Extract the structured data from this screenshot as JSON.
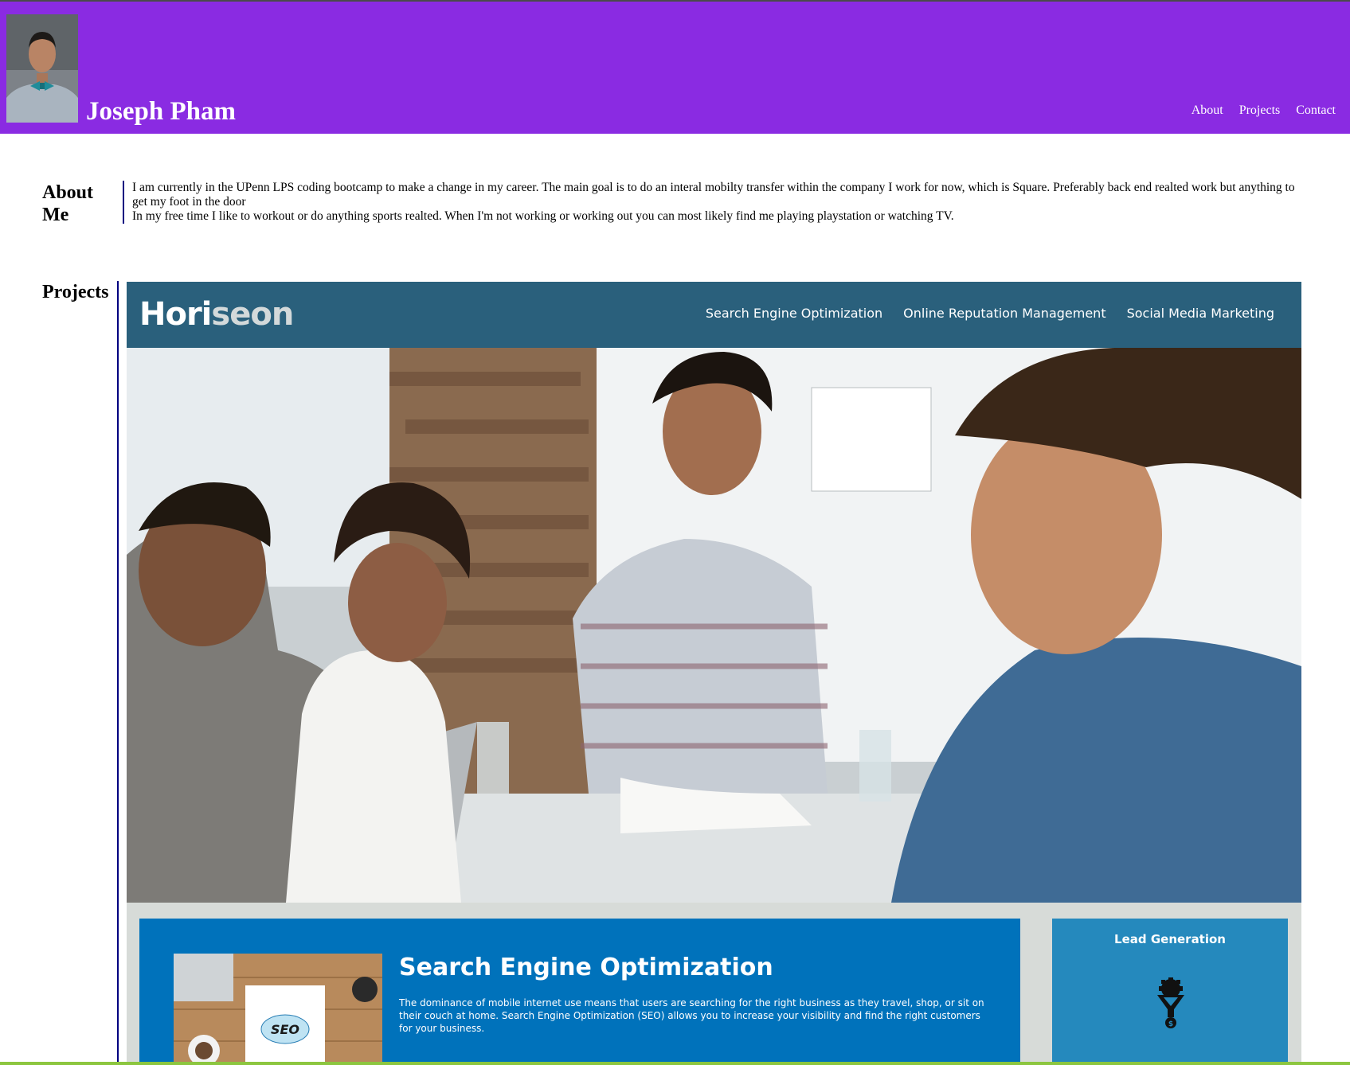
{
  "site": {
    "name": "Joseph Pham",
    "avatar_alt": "avatar"
  },
  "nav": {
    "about": "About",
    "projects": "Projects",
    "contact": "Contact"
  },
  "about": {
    "title": "About Me",
    "paragraph1": "I am currently in the UPenn LPS coding bootcamp to make a change in my career. The main goal is to do an interal mobilty transfer within the company I work for now, which is Square. Preferably back end realted work but anything to get my foot in the door",
    "paragraph2": "In my free time I like to workout or do anything sports realted. When I'm not working or working out you can most likely find me playing playstation or watching TV."
  },
  "projects": {
    "title": "Projects",
    "horiseon": {
      "logo_a": "Hori",
      "logo_b": "seon",
      "nav": [
        "Search Engine Optimization",
        "Online Reputation Management",
        "Social Media Marketing"
      ],
      "seo_title": "Search Engine Optimization",
      "seo_text": "The dominance of mobile internet use means that users are searching for the right business as they travel, shop, or sit on their couch at home. Search Engine Optimization (SEO) allows you to increase your visibility and find the right customers for your business.",
      "seo_image_label": "SEO",
      "lead_title": "Lead Generation",
      "lead_icon": "funnel-gear-icon"
    }
  },
  "colors": {
    "header": "#8a2be2",
    "horiseon_header": "#2a607c",
    "seo_card": "#0072bb",
    "lead_card": "#2589bd",
    "rule": "#000080"
  }
}
